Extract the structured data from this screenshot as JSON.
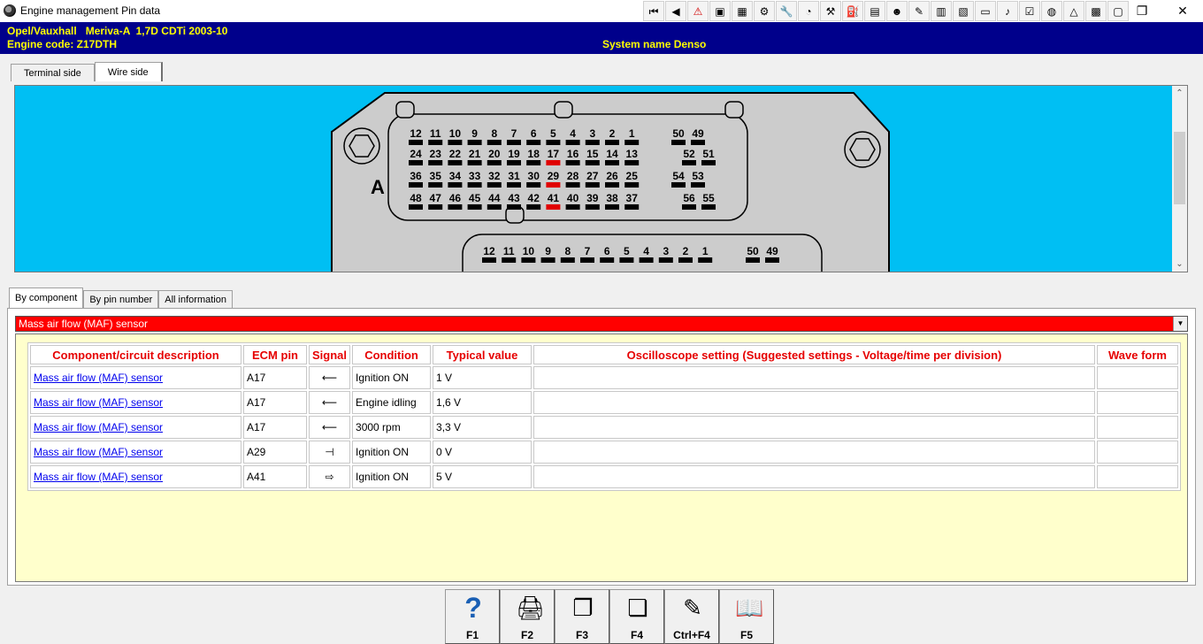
{
  "window": {
    "title": "Engine management Pin data"
  },
  "toolbar": {
    "icons": [
      "first-page-icon",
      "previous-icon",
      "warning-icon",
      "flag-icon",
      "map-icon",
      "gear-icon",
      "wrench-icon",
      "clock-icon",
      "tool-icon",
      "fuel-icon",
      "garage-icon",
      "people-icon",
      "pencil-icon",
      "chart-icon",
      "table-icon",
      "computer-icon",
      "bell-icon",
      "checklist-icon",
      "globe-icon",
      "caution-icon",
      "cassette-icon",
      "note-icon"
    ],
    "glyphs": [
      "⏮",
      "◀",
      "⚠",
      "▣",
      "▦",
      "⚙",
      "🔧",
      "◔",
      "⚒",
      "⛽",
      "▤",
      "☻",
      "✎",
      "▥",
      "▧",
      "▭",
      "♪",
      "☑",
      "◍",
      "△",
      "▩",
      "▢"
    ]
  },
  "window_controls": {
    "restore": "❐",
    "close": "✕"
  },
  "header": {
    "vehicle": "Opel/Vauxhall   Meriva-A  1,7D CDTi 2003-10",
    "engine_code": "Engine code: Z17DTH",
    "system_name": "System name Denso"
  },
  "top_tabs": [
    "Terminal side",
    "Wire side"
  ],
  "diagram": {
    "connector_label": "A",
    "rows": [
      [
        "12",
        "11",
        "10",
        "9",
        "8",
        "7",
        "6",
        "5",
        "4",
        "3",
        "2",
        "1"
      ],
      [
        "24",
        "23",
        "22",
        "21",
        "20",
        "19",
        "18",
        "17",
        "16",
        "15",
        "14",
        "13"
      ],
      [
        "36",
        "35",
        "34",
        "33",
        "32",
        "31",
        "30",
        "29",
        "28",
        "27",
        "26",
        "25"
      ],
      [
        "48",
        "47",
        "46",
        "45",
        "44",
        "43",
        "42",
        "41",
        "40",
        "39",
        "38",
        "37"
      ]
    ],
    "right_pins": [
      [
        "50",
        "49"
      ],
      [
        "52",
        "51"
      ],
      [
        "54",
        "53"
      ],
      [
        "56",
        "55"
      ]
    ],
    "highlighted": [
      "17",
      "29",
      "41"
    ],
    "second_row": [
      "12",
      "11",
      "10",
      "9",
      "8",
      "7",
      "6",
      "5",
      "4",
      "3",
      "2",
      "1"
    ],
    "second_right": [
      "50",
      "49"
    ],
    "colors": {
      "background": "#00bff3",
      "housing": "#cccccc",
      "pin": "#000000",
      "highlight": "#e00000"
    }
  },
  "bottom_tabs": [
    "By component",
    "By pin number",
    "All information"
  ],
  "component_select": {
    "value": "Mass air flow (MAF) sensor"
  },
  "table": {
    "headers": [
      "Component/circuit description",
      "ECM pin",
      "Signal",
      "Condition",
      "Typical value",
      "Oscilloscope setting (Suggested settings - Voltage/time per division)",
      "Wave form"
    ],
    "rows": [
      {
        "component": "Mass air flow (MAF) sensor",
        "pin": "A17",
        "signal": "input-arrow-icon",
        "glyph": "⟵",
        "condition": "Ignition ON",
        "value": "1 V"
      },
      {
        "component": "Mass air flow (MAF) sensor",
        "pin": "A17",
        "signal": "input-arrow-icon",
        "glyph": "⟵",
        "condition": "Engine idling",
        "value": "1,6 V"
      },
      {
        "component": "Mass air flow (MAF) sensor",
        "pin": "A17",
        "signal": "input-arrow-icon",
        "glyph": "⟵",
        "condition": "3000 rpm",
        "value": "3,3 V"
      },
      {
        "component": "Mass air flow (MAF) sensor",
        "pin": "A29",
        "signal": "ground-icon",
        "glyph": "⊣",
        "condition": "Ignition ON",
        "value": "0 V"
      },
      {
        "component": "Mass air flow (MAF) sensor",
        "pin": "A41",
        "signal": "output-arrow-icon",
        "glyph": "⇨",
        "condition": "Ignition ON",
        "value": "5 V"
      }
    ]
  },
  "footer_buttons": [
    {
      "key": "F1",
      "icon": "help-icon",
      "glyph": "?"
    },
    {
      "key": "F2",
      "icon": "printer-icon",
      "glyph": "🖨"
    },
    {
      "key": "F3",
      "icon": "copy-icon",
      "glyph": "❐"
    },
    {
      "key": "F4",
      "icon": "copy-window-icon",
      "glyph": "❏"
    },
    {
      "key": "Ctrl+F4",
      "icon": "notes-icon",
      "glyph": "✎"
    },
    {
      "key": "F5",
      "icon": "book-icon",
      "glyph": "📖"
    }
  ]
}
